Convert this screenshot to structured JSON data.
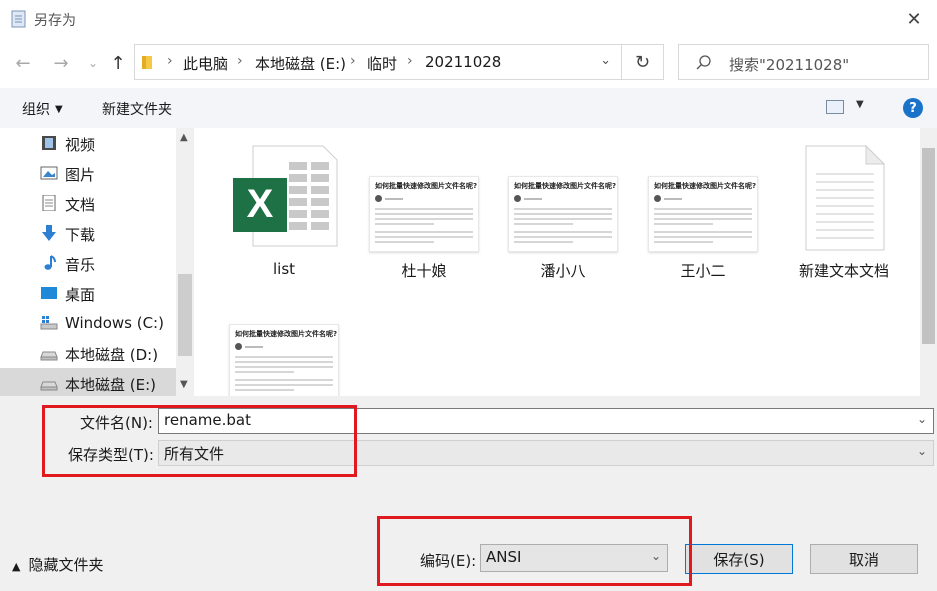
{
  "window": {
    "title": "另存为",
    "close_glyph": "✕"
  },
  "navigation": {
    "back_glyph": "←",
    "forward_glyph": "→",
    "recent_glyph": "⌄",
    "up_glyph": "↑",
    "breadcrumbs": [
      "此电脑",
      "本地磁盘 (E:)",
      "临时",
      "20211028"
    ],
    "breadcrumb_separator": "›",
    "refresh_glyph": "↻",
    "search_placeholder": "搜索\"20211028\""
  },
  "toolbar": {
    "organize_label": "组织",
    "new_folder_label": "新建文件夹",
    "help_label": "?"
  },
  "sidebar": {
    "items": [
      {
        "label": "视频",
        "icon": "video-icon"
      },
      {
        "label": "图片",
        "icon": "pictures-icon"
      },
      {
        "label": "文档",
        "icon": "documents-icon"
      },
      {
        "label": "下载",
        "icon": "downloads-icon"
      },
      {
        "label": "音乐",
        "icon": "music-icon"
      },
      {
        "label": "桌面",
        "icon": "desktop-icon"
      },
      {
        "label": "Windows (C:)",
        "icon": "windows-drive-icon"
      },
      {
        "label": "本地磁盘 (D:)",
        "icon": "drive-icon"
      },
      {
        "label": "本地磁盘 (E:)",
        "icon": "drive-icon",
        "selected": true
      }
    ]
  },
  "files": [
    {
      "label": "list",
      "type": "excel"
    },
    {
      "label": "杜十娘",
      "type": "doc-preview"
    },
    {
      "label": "潘小八",
      "type": "doc-preview"
    },
    {
      "label": "王小二",
      "type": "doc-preview"
    },
    {
      "label": "新建文本文档",
      "type": "text"
    },
    {
      "label": "",
      "type": "doc-preview"
    }
  ],
  "doc_preview_title": "如何批量快速修改图片文件名呢?",
  "form": {
    "filename_label": "文件名(N):",
    "filename_value": "rename.bat",
    "filetype_label": "保存类型(T):",
    "filetype_value": "所有文件",
    "encoding_label": "编码(E):",
    "encoding_value": "ANSI",
    "save_label": "保存(S)",
    "cancel_label": "取消",
    "hide_folders_label": "隐藏文件夹"
  },
  "colors": {
    "highlight": "#e0191f",
    "accent": "#0078d7",
    "excel_green": "#1e7145"
  }
}
